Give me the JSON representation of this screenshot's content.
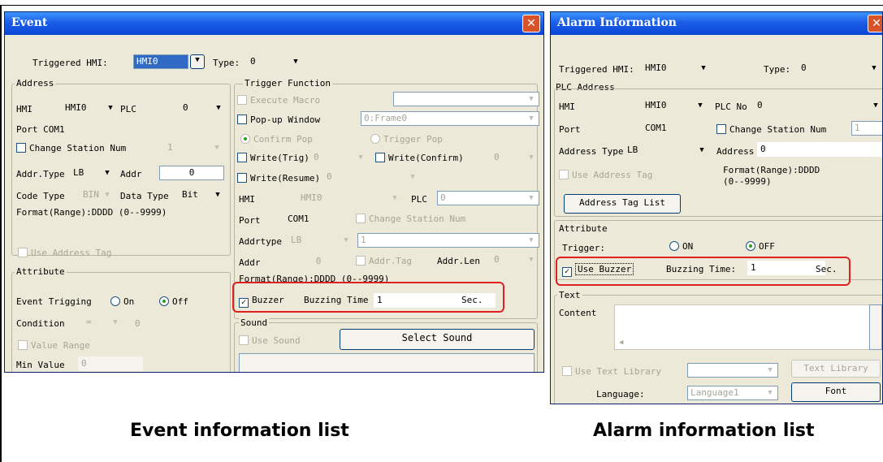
{
  "event": {
    "title": "Event",
    "triggered_hmi_label": "Triggered HMI:",
    "triggered_hmi_value": "HMI0",
    "type_label": "Type:",
    "type_value": "0",
    "address": {
      "group": "Address",
      "hmi_label": "HMI",
      "hmi_value": "HMI0",
      "plc_label": "PLC",
      "plc_value": "0",
      "port_label": "Port",
      "port_value": "COM1",
      "change_station_label": "Change Station Num",
      "change_station_value": "1",
      "addr_type_label": "Addr.Type",
      "addr_type_value": "LB",
      "addr_label": "Addr",
      "addr_value": "0",
      "code_type_label": "Code Type",
      "code_type_value": "BIN",
      "data_type_label": "Data Type",
      "data_type_value": "Bit",
      "format": "Format(Range):DDDD (0--9999)",
      "use_address_tag": "Use Address Tag"
    },
    "attribute": {
      "group": "Attribute",
      "event_trigging_label": "Event Trigging",
      "on_label": "On",
      "off_label": "Off",
      "condition_label": "Condition",
      "condition_value": "=",
      "condition_num": "0",
      "value_range": "Value Range",
      "min_value_label": "Min Value",
      "min_value": "0"
    },
    "trigger": {
      "group": "Trigger Function",
      "execute_macro": "Execute Macro",
      "popup_window": "Pop-up Window",
      "popup_value": "0:Frame0",
      "confirm_pop": "Confirm Pop",
      "trigger_pop": "Trigger Pop",
      "write_trig": "Write(Trig)",
      "write_trig_val": "0",
      "write_confirm": "Write(Confirm)",
      "write_confirm_val": "0",
      "write_resume": "Write(Resume)",
      "write_resume_val": "0",
      "hmi_label": "HMI",
      "hmi_value": "HMI0",
      "plc_label": "PLC",
      "plc_value": "0",
      "port_label": "Port",
      "port_value": "COM1",
      "change_station": "Change Station Num",
      "addrtype_label": "Addrtype",
      "addrtype_value": "LB",
      "addrtype_value2": "1",
      "addr_label": "Addr",
      "addr_value": "0",
      "addr_tag": "Addr.Tag",
      "addr_len_label": "Addr.Len",
      "addr_len_value": "0",
      "format": "Format(Range):DDDD (0--9999)",
      "buzzer_label": "Buzzer",
      "buzzing_time_label": "Buzzing Time",
      "buzzing_time_value": "1",
      "sec_label": "Sec."
    },
    "sound": {
      "group": "Sound",
      "use_sound": "Use Sound",
      "select_sound": "Select Sound"
    }
  },
  "alarm": {
    "title": "Alarm Information",
    "triggered_hmi_label": "Triggered HMI:",
    "triggered_hmi_value": "HMI0",
    "type_label": "Type:",
    "type_value": "0",
    "plc_address": {
      "group": "PLC Address",
      "hmi_label": "HMI",
      "hmi_value": "HMI0",
      "plc_no_label": "PLC No",
      "plc_no_value": "0",
      "port_label": "Port",
      "port_value": "COM1",
      "change_station": "Change Station Num",
      "change_station_value": "1",
      "address_type_label": "Address Type",
      "address_type_value": "LB",
      "address_label": "Address",
      "address_value": "0",
      "use_address_tag": "Use Address Tag",
      "format": "Format(Range):DDDD",
      "format_range": "(0--9999)",
      "address_tag_list": "Address Tag List"
    },
    "attribute": {
      "group": "Attribute",
      "trigger_label": "Trigger:",
      "on_label": "ON",
      "off_label": "OFF",
      "use_buzzer": "Use Buzzer",
      "buzzing_time_label": "Buzzing Time:",
      "buzzing_time_value": "1",
      "sec_label": "Sec."
    },
    "text": {
      "group": "Text",
      "content_label": "Content",
      "use_text_library": "Use Text Library",
      "text_library": "Text Library",
      "language_label": "Language:",
      "language_value": "Language1",
      "font": "Font"
    }
  },
  "captions": {
    "event": "Event information list",
    "alarm": "Alarm information list"
  },
  "colors": {
    "titlebar": "#0a46d6",
    "dialog_bg": "#ece9d8",
    "highlight": "#e02020"
  }
}
